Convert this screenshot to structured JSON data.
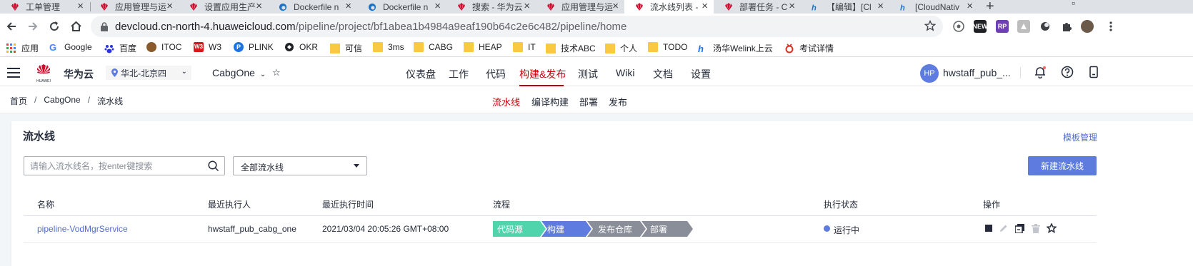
{
  "browser": {
    "tabs": [
      {
        "title": "工单管理",
        "active": false
      },
      {
        "title": "应用管理与运维平台",
        "active": false
      },
      {
        "title": "设置应用生产",
        "active": false
      },
      {
        "title": "Dockerfile n",
        "active": false
      },
      {
        "title": "Dockerfile n",
        "active": false
      },
      {
        "title": "搜索 - 华为云",
        "active": false
      },
      {
        "title": "应用管理与运维",
        "active": false
      },
      {
        "title": "流水线列表 -",
        "active": true
      },
      {
        "title": "部署任务 - C",
        "active": false
      },
      {
        "title": "【编辑】[Cl",
        "active": false
      },
      {
        "title": "[CloudNativ",
        "active": false
      }
    ],
    "new_tab": "+",
    "url_host": "devcloud.cn-north-4.huaweicloud.com",
    "url_path": "/pipeline/project/bf1abea1b4984a9eaf190b64c2e6c482/pipeline/home",
    "extensions": {
      "ext3": "NEW",
      "ext4": "RP"
    },
    "bookmarks": [
      "应用",
      "Google",
      "百度",
      "ITOC",
      "W3",
      "PLINK",
      "OKR",
      "可信",
      "3ms",
      "CABG",
      "HEAP",
      "IT",
      "技术ABC",
      "个人",
      "TODO",
      "汤华Welink上云",
      "考试详情"
    ]
  },
  "header": {
    "brand": "华为云",
    "region": "华北-北京四",
    "project": "CabgOne",
    "nav": [
      "仪表盘",
      "工作",
      "代码",
      "构建&发布",
      "测试",
      "Wiki",
      "文档",
      "设置"
    ],
    "active_nav": "构建&发布",
    "avatar_initials": "HP",
    "username": "hwstaff_pub_..."
  },
  "breadcrumb": {
    "home": "首页",
    "project": "CabgOne",
    "current": "流水线"
  },
  "subnav": [
    "流水线",
    "编译构建",
    "部署",
    "发布"
  ],
  "main": {
    "title": "流水线",
    "template_link": "模板管理",
    "search_placeholder": "请输入流水线名，按enter键搜索",
    "filter_value": "全部流水线",
    "new_button": "新建流水线",
    "columns": [
      "名称",
      "最近执行人",
      "最近执行时间",
      "流程",
      "执行状态",
      "操作"
    ],
    "rows": [
      {
        "name": "pipeline-VodMgrService",
        "executor": "hwstaff_pub_cabg_one",
        "time": "2021/03/04 20:05:26 GMT+08:00",
        "stages": [
          "代码源",
          "构建",
          "发布仓库",
          "部署"
        ],
        "status": "运行中"
      }
    ]
  },
  "colors": {
    "brand_red": "#c7000b",
    "primary_blue": "#5e7ce0",
    "link_blue": "#526ecc",
    "stage_source": "#50d4ab",
    "stage_build": "#5e7ce0",
    "stage_pending": "#8a8e99"
  }
}
